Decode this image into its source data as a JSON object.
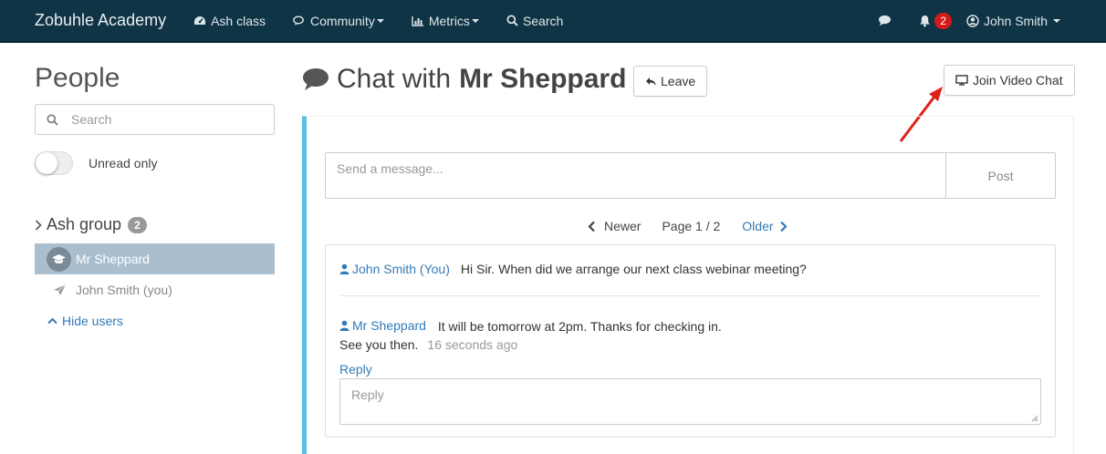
{
  "navbar": {
    "brand": "Zobuhle Academy",
    "items": [
      {
        "label": "Ash class",
        "icon": "dashboard-icon"
      },
      {
        "label": "Community",
        "icon": "comments-icon",
        "dropdown": true
      },
      {
        "label": "Metrics",
        "icon": "bar-chart-icon",
        "dropdown": true
      },
      {
        "label": "Search",
        "icon": "search-icon"
      }
    ],
    "notification_count": "2",
    "user_name": "John Smith"
  },
  "sidebar": {
    "title": "People",
    "search_placeholder": "Search",
    "unread_toggle_label": "Unread only",
    "unread_toggle_on": false,
    "group_name": "Ash group",
    "group_count": "2",
    "users": [
      {
        "name": "Mr Sheppard",
        "selected": true,
        "icon": "graduation-cap-icon"
      },
      {
        "name": "John Smith (you)",
        "selected": false,
        "icon": "paper-plane-icon"
      }
    ],
    "hide_users_label": "Hide users"
  },
  "main": {
    "title_prefix": "Chat with",
    "title_name": "Mr Sheppard",
    "leave_label": "Leave",
    "video_chat_label": "Join Video Chat",
    "message_placeholder": "Send a message...",
    "post_label": "Post",
    "pager": {
      "newer_label": "Newer",
      "page_label": "Page 1 / 2",
      "older_label": "Older"
    },
    "messages": [
      {
        "author": "John Smith (You)",
        "text": "Hi Sir. When did we arrange our next class webinar meeting?"
      },
      {
        "author": "Mr Sheppard",
        "text_line1": "It will be tomorrow at 2pm. Thanks for checking in.",
        "text_line2": "See you then.",
        "timestamp": "16 seconds ago"
      }
    ],
    "reply_link_label": "Reply",
    "reply_placeholder": "Reply"
  },
  "colors": {
    "navbar_bg": "#0f3445",
    "link": "#337ab7",
    "accent_border": "#5bc0de",
    "selected_user_bg": "#a9bfd0",
    "badge_red": "#d4191a",
    "annotation_arrow": "#e0201b"
  }
}
